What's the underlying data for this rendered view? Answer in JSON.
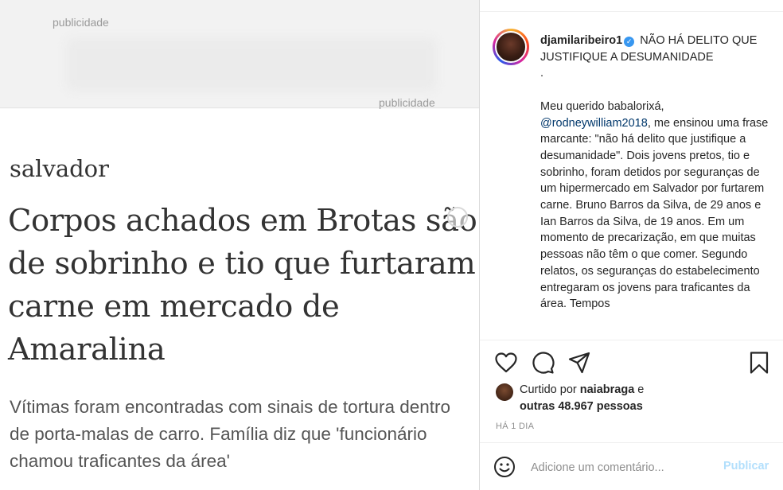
{
  "post_image": {
    "ad_label_1": "publicidade",
    "ad_label_2": "publicidade",
    "section": "salvador",
    "headline": "Corpos achados em Brotas são de sobrinho e tio que furtaram carne em mercado de Amaralina",
    "subhead": "Vítimas foram encontradas com sinais de tortura dentro de porta-malas de carro. Família diz que 'funcionário chamou traficantes da área'"
  },
  "post": {
    "username": "djamilaribeiro1",
    "verified_icon": "verified-badge-icon",
    "caption_title": "NÃO HÁ DELITO QUE JUSTIFIQUE A DESUMANIDADE",
    "caption_dot": ".",
    "caption_intro": "Meu querido babalorixá,",
    "mention": "@rodneywilliam2018",
    "caption_body": ", me ensinou uma frase marcante: \"não há delito que justifique a desumanidade\". Dois jovens pretos, tio e sobrinho, foram detidos por seguranças de um hipermercado em Salvador por furtarem carne. Bruno Barros da Silva, de 29 anos e Ian Barros da Silva, de 19 anos. Em um momento de precarização, em que muitas pessoas não têm o que comer. Segundo relatos, os seguranças do estabelecimento entregaram os jovens para traficantes da área. Tempos"
  },
  "actions": {
    "like_icon": "heart-icon",
    "comment_icon": "comment-bubble-icon",
    "share_icon": "paper-plane-icon",
    "save_icon": "bookmark-icon"
  },
  "likes": {
    "prefix": "Curtido por ",
    "liker": "naiabraga",
    "mid": " e",
    "count_text": "outras 48.967 pessoas"
  },
  "timestamp": "HÁ 1 DIA",
  "comment": {
    "emoji_icon": "smiley-icon",
    "placeholder": "Adicione um comentário...",
    "publish_label": "Publicar"
  },
  "colors": {
    "link": "#00376b",
    "verified": "#3897f0",
    "publish_disabled": "#b2dffc"
  }
}
